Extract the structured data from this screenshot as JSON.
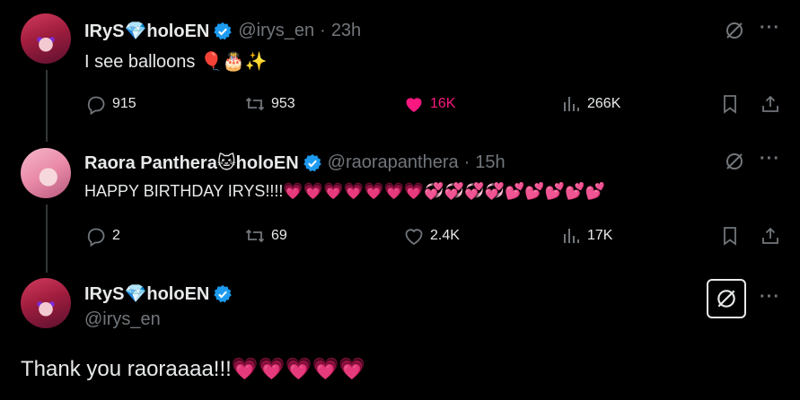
{
  "colors": {
    "background": "#000000",
    "text": "#e7e9ea",
    "muted": "#71767b",
    "like": "#f91880",
    "verified": "#1d9bf0"
  },
  "tweet1": {
    "name": "IRyS💎holoEN",
    "handle": "@irys_en",
    "time": "23h",
    "text": "I see balloons 🎈🎂✨",
    "replies": "915",
    "reposts": "953",
    "likes": "16K",
    "views": "266K",
    "liked": true
  },
  "tweet2": {
    "name": "Raora Panthera🐱holoEN",
    "handle": "@raorapanthera",
    "time": "15h",
    "text": "HAPPY BIRTHDAY IRYS!!!!💗💗💗💗💗💗💗💞💞💞💞💕💕💕💕💕",
    "replies": "2",
    "reposts": "69",
    "likes": "2.4K",
    "views": "17K"
  },
  "tweet3": {
    "name": "IRyS💎holoEN",
    "handle": "@irys_en",
    "text": "Thank you raoraaaa!!!💗💗💗💗💗"
  },
  "icons": [
    "reply-icon",
    "repost-icon",
    "like-icon",
    "views-icon",
    "bookmark-icon",
    "share-icon",
    "grok-icon",
    "more-icon",
    "verified-badge-icon"
  ]
}
